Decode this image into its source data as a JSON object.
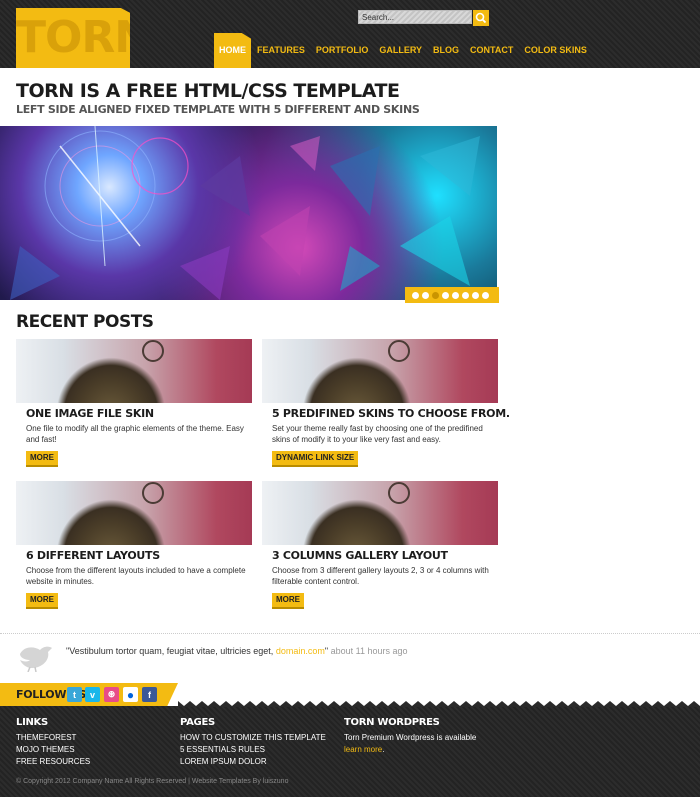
{
  "header": {
    "logo_text": "TORN",
    "search_value": "Search...",
    "nav": [
      "HOME",
      "FEATURES",
      "PORTFOLIO",
      "GALLERY",
      "BLOG",
      "CONTACT",
      "COLOR SKINS"
    ]
  },
  "intro": {
    "title": "TORN IS A FREE HTML/CSS TEMPLATE",
    "subtitle": "LEFT SIDE ALIGNED FIXED TEMPLATE WITH 5 DIFFERENT AND SKINS"
  },
  "slider": {
    "dot_count": 8,
    "active_index": 2
  },
  "recent": {
    "title": "RECENT POSTS",
    "posts": [
      {
        "title": "ONE IMAGE FILE SKIN",
        "desc": "One file to modify all the graphic elements of the theme. Easy and fast!",
        "button": "MORE"
      },
      {
        "title": "5 PREDIFINED SKINS TO CHOOSE FROM.",
        "desc": "Set your theme really fast by choosing one of the predifined skins of modify it to your like very fast and easy.",
        "button": "DYNAMIC LINK SIZE"
      },
      {
        "title": "6 DIFFERENT LAYOUTS",
        "desc": "Choose from the different layouts included to have a complete website in minutes.",
        "button": "MORE"
      },
      {
        "title": "3 COLUMNS GALLERY LAYOUT",
        "desc": "Choose from 3 different gallery layouts 2, 3 or 4 columns with filterable content control.",
        "button": "MORE"
      }
    ]
  },
  "tweet": {
    "text": "\"Vestibulum tortor quam, feugiat vitae, ultricies eget,",
    "link": "domain.com",
    "closing": "\"",
    "time": "about 11 hours ago"
  },
  "footer": {
    "follow_label": "FOLLOW US",
    "social_icons": [
      "twitter-icon",
      "vimeo-icon",
      "dribbble-icon",
      "flickr-icon",
      "facebook-icon"
    ],
    "columns": {
      "links": {
        "title": "LINKS",
        "items": [
          "THEMEFOREST",
          "MOJO THEMES",
          "FREE RESOURCES"
        ]
      },
      "pages": {
        "title": "PAGES",
        "items": [
          "HOW TO CUSTOMIZE THIS TEMPLATE",
          "5 ESSENTIALS RULES",
          "LOREM IPSUM DOLOR"
        ]
      },
      "wordpress": {
        "title": "TORN WORDPRES",
        "text": "Torn Premium Wordpress is available",
        "link": "learn more",
        "suffix": "."
      }
    },
    "copyright": "© Copyright 2012 Company Name All Rights Reserved | Website Templates By luiszuno"
  },
  "colors": {
    "accent": "#f3bb12",
    "dark": "#2a2a2a",
    "text": "#1c1c1c"
  }
}
